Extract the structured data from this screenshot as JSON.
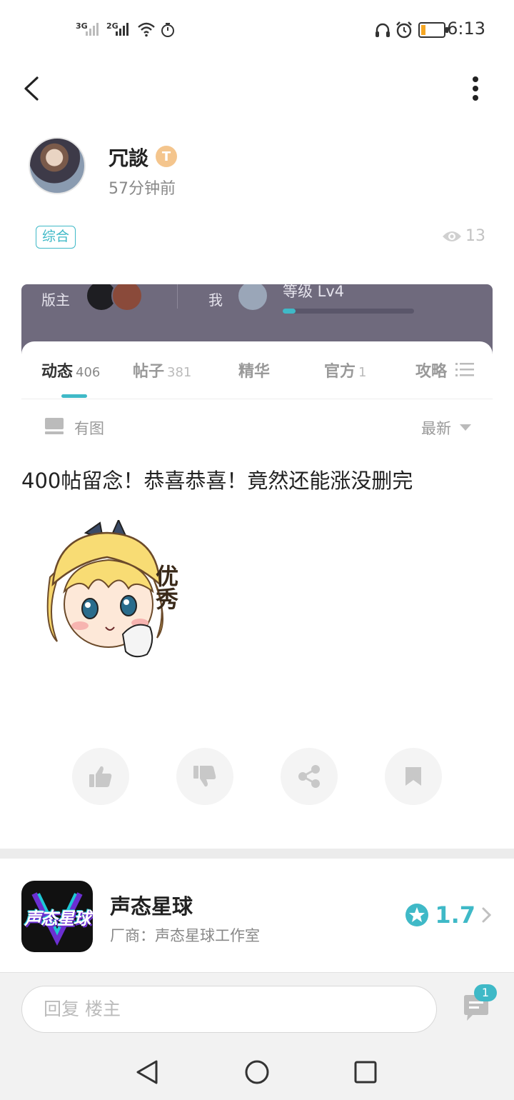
{
  "status_bar": {
    "net1": "3G",
    "net2": "2G",
    "time": "6:13",
    "battery_level": 0.2,
    "battery_color": "#f5a623"
  },
  "topbar": {
    "back_icon": "chevron-left-icon",
    "more_icon": "more-vertical-icon"
  },
  "post": {
    "author": "冗談",
    "badge": "T",
    "time_ago": "57分钟前",
    "tag": "综合",
    "views": "13",
    "text": "400帖留念！恭喜恭喜！竟然还能涨没删完"
  },
  "embedded": {
    "moderator_label": "版主",
    "me_label": "我",
    "level": "等级 Lv4",
    "level_progress": 0.1,
    "tabs": [
      {
        "label": "动态",
        "count": "406"
      },
      {
        "label": "帖子",
        "count": "381"
      },
      {
        "label": "精华",
        "count": ""
      },
      {
        "label": "官方",
        "count": "1"
      },
      {
        "label": "攻略",
        "count": ""
      }
    ],
    "filter_left": "有图",
    "filter_right": "最新"
  },
  "sticker": {
    "text": "优秀"
  },
  "actions": [
    "thumb-up-icon",
    "thumb-down-icon",
    "share-icon",
    "bookmark-icon"
  ],
  "app": {
    "name": "声态星球",
    "vendor": "厂商：声态星球工作室",
    "rating": "1.7",
    "logo_text": "声态星球"
  },
  "reply": {
    "placeholder": "回复  楼主",
    "comment_count": "1"
  },
  "colors": {
    "accent": "#3fb9c7"
  }
}
